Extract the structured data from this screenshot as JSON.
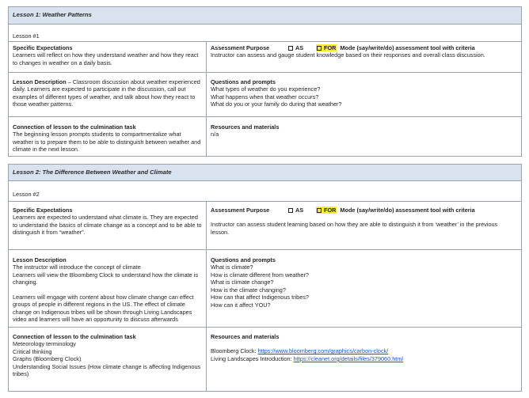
{
  "lesson1": {
    "title": "Lesson 1: Weather Patterns",
    "number": "Lesson #1",
    "expectations_heading": "Specific Expectations",
    "expectations_text": "Learners will reflect on how they understand weather and how they react to changes in weather on a daily basis.",
    "assessment_heading": "Assessment Purpose",
    "as_label": "AS",
    "for_label": "FOR",
    "mode_label": "Mode (say/write/do) assessment tool with criteria",
    "assessment_text": "Instructor can assess and gauge student knowledge based on their responses and overall class discussion.",
    "description_heading": "Lesson Description",
    "description_text": " – Classroom discussion about weather experienced daily. Learners are expected to participate in the discussion, call out examples of different types of weather, and talk about how they react to those weather patterns.",
    "questions_heading": "Questions and prompts",
    "questions": [
      "What types of weather do you experience?",
      "What happens when that weather occurs?",
      "What do you or your family do during that weather?"
    ],
    "connection_heading": "Connection of lesson to the culmination task",
    "connection_text": "The beginning lesson prompts students to compartmentalize what weather is to prepare them to be able to distinguish between weather and climate in the next lesson.",
    "resources_heading": "Resources and materials",
    "resources_text": "n/a"
  },
  "lesson2": {
    "title": "Lesson 2: The Difference Between Weather and Climate",
    "number": "Lesson #2",
    "expectations_heading": "Specific Expectations",
    "expectations_text": "Learners are expected to understand what climate is. They are expected to understand the basics of climate change as a concept and to be able to distinguish it from “weather”.",
    "assessment_heading": "Assessment Purpose",
    "as_label": "AS",
    "for_label": "FOR",
    "mode_label": "Mode (say/write/do) assessment tool with criteria",
    "assessment_text": "Instructor can assess student learning based on how they are able to distinguish it from ‘weather’ in the previous lesson.",
    "description_heading": "Lesson Description",
    "description_p1": "The instructor will introduce the concept of climate",
    "description_p2": "Learners will view the Bloomberg Clock to understand how the climate is changing.",
    "description_p3": "Learners will engage with content about how climate change can effect groups of people in different regions in the US. The effect of climate change on Indigenous tribes will be shown through Living Landscapes video and learners will have an opportunity to discuss afterwards",
    "questions_heading": "Questions and prompts",
    "questions": [
      "What is climate?",
      "How is climate different from weather?",
      "What is climate change?",
      "How is the climate changing?",
      "How can that affect Indigenous tribes?",
      "How can it affect YOU?"
    ],
    "connection_heading": "Connection of lesson to the culmination task",
    "connection_items": [
      "Meteorology terminology",
      "Critical thinking",
      "Graphs (Bloomberg Clock)",
      "Understanding Social Issues (How climate change is affecting Indigenous tribes)"
    ],
    "resources_heading": "Resources and materials",
    "resource1_label": "Bloomberg Clock: ",
    "resource1_link": "https://www.bloomberg.com/graphics/carbon-clock/",
    "resource2_label": "Living Landscapes Introduction: ",
    "resource2_link": "https://cleanet.org/details/files/379060.html"
  }
}
